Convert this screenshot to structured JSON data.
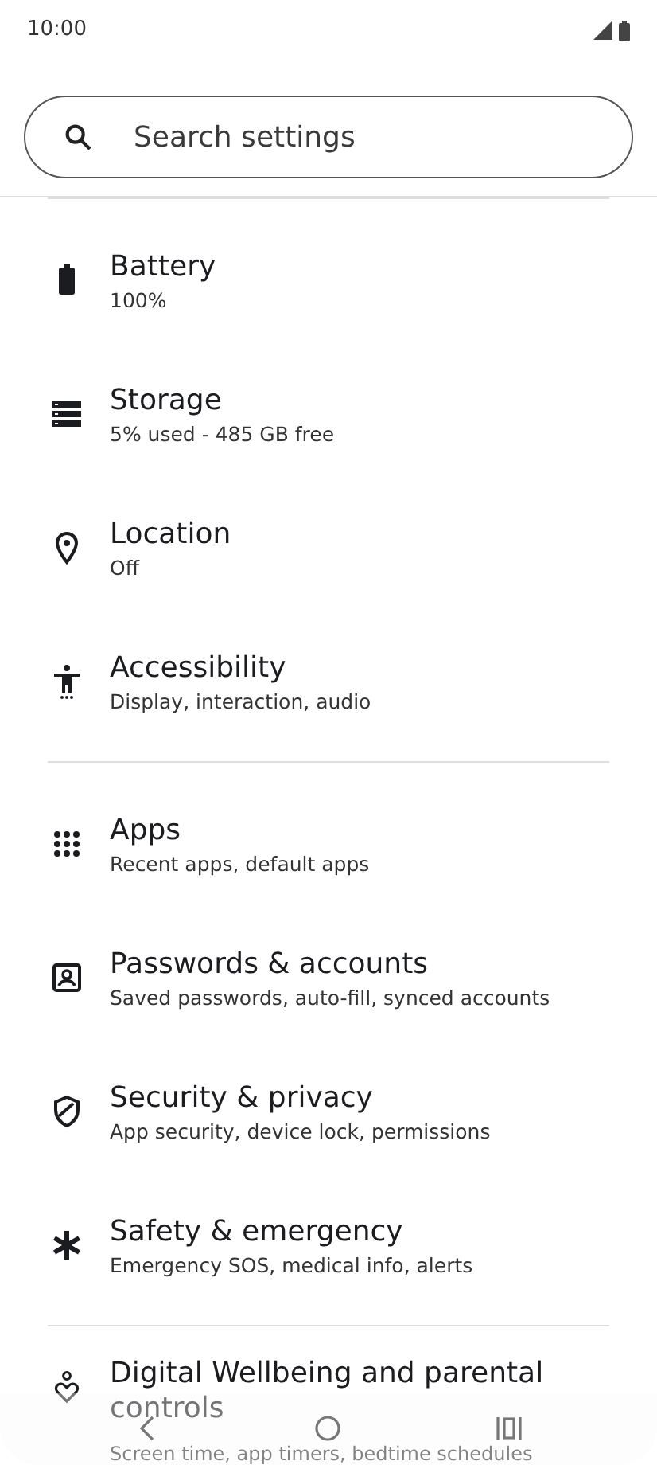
{
  "status_bar": {
    "time": "10:00"
  },
  "search": {
    "placeholder": "Search settings"
  },
  "sections": [
    {
      "items": [
        {
          "kind": "battery",
          "title": "Battery",
          "subtitle": "100%"
        },
        {
          "kind": "storage",
          "title": "Storage",
          "subtitle": "5% used - 485 GB free"
        },
        {
          "kind": "location",
          "title": "Location",
          "subtitle": "Off"
        },
        {
          "kind": "accessibility",
          "title": "Accessibility",
          "subtitle": "Display, interaction, audio"
        }
      ]
    },
    {
      "items": [
        {
          "kind": "apps",
          "title": "Apps",
          "subtitle": "Recent apps, default apps"
        },
        {
          "kind": "account",
          "title": "Passwords & accounts",
          "subtitle": "Saved passwords, auto-fill, synced accounts"
        },
        {
          "kind": "shield",
          "title": "Security & privacy",
          "subtitle": "App security, device lock, permissions"
        },
        {
          "kind": "asterisk",
          "title": "Safety & emergency",
          "subtitle": "Emergency SOS, medical info, alerts"
        }
      ]
    },
    {
      "items": [
        {
          "kind": "wellbeing",
          "title": "Digital Wellbeing and parental controls",
          "subtitle": "Screen time, app timers, bedtime schedules"
        }
      ]
    }
  ]
}
